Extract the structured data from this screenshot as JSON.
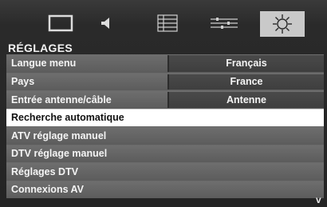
{
  "menu": {
    "tabs": [
      {
        "icon": "tv-picture-icon"
      },
      {
        "icon": "speaker-icon"
      },
      {
        "icon": "list-icon"
      },
      {
        "icon": "equalizer-icon"
      },
      {
        "icon": "gear-icon",
        "selected": true
      }
    ],
    "section_title": "RÉGLAGES",
    "rows": [
      {
        "label": "Langue menu",
        "value": "Français"
      },
      {
        "label": "Pays",
        "value": "France"
      },
      {
        "label": "Entrée antenne/câble",
        "value": "Antenne"
      },
      {
        "label": "Recherche automatique",
        "selected": true
      },
      {
        "label": "ATV réglage manuel"
      },
      {
        "label": "DTV réglage manuel"
      },
      {
        "label": "Réglages DTV"
      },
      {
        "label": "Connexions AV"
      }
    ],
    "scroll_indicator": "v"
  }
}
